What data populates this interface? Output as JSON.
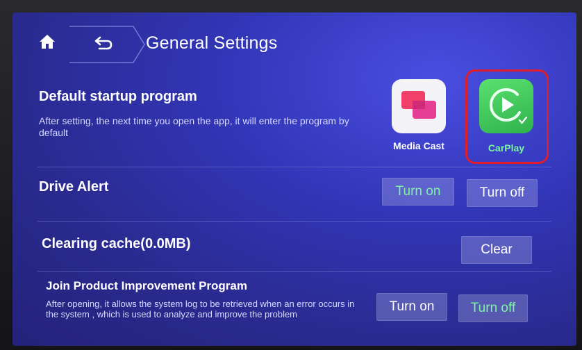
{
  "header": {
    "title": "General Settings"
  },
  "icons": {
    "home": "home-icon",
    "back": "back-arrow-icon",
    "media_cast": "media-cast-icon",
    "carplay": "carplay-play-icon",
    "check": "check-icon"
  },
  "startup": {
    "label": "Default startup program",
    "description": "After setting, the next time you open the app, it will enter the program by default",
    "apps": [
      {
        "name": "Media Cast",
        "selected": false
      },
      {
        "name": "CarPlay",
        "selected": true
      }
    ]
  },
  "drive_alert": {
    "label": "Drive Alert",
    "on_label": "Turn on",
    "off_label": "Turn off",
    "state": "on"
  },
  "cache": {
    "label": "Clearing cache(0.0MB)",
    "clear_label": "Clear"
  },
  "improvement": {
    "label": "Join Product Improvement Program",
    "description": "After opening, it allows the system log to be retrieved when an error occurs in the system , which is used to analyze and improve the problem",
    "on_label": "Turn on",
    "off_label": "Turn off",
    "state": "off"
  },
  "colors": {
    "active_text": "#7cf5a0",
    "highlight": "#e11d2a",
    "background": "#3236b8"
  }
}
